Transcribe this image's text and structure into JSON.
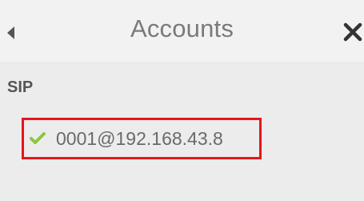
{
  "header": {
    "title": "Accounts",
    "back_icon": "chevron-left-icon",
    "close_icon": "close-icon"
  },
  "section": {
    "label": "SIP"
  },
  "accounts": [
    {
      "address": "0001@192.168.43.8",
      "status_icon": "check-icon",
      "status_color": "#8dc63f",
      "highlighted": true,
      "highlight_color": "#e8141c"
    }
  ]
}
